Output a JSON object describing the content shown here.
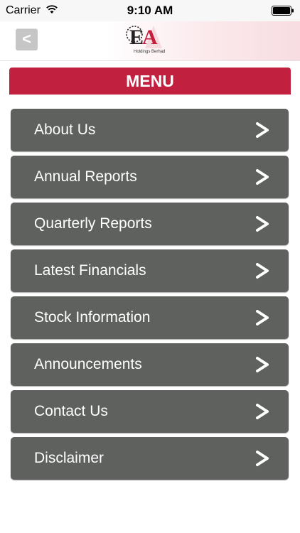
{
  "status_bar": {
    "carrier": "Carrier",
    "time": "9:10 AM",
    "wifi_icon": "wifi-icon",
    "battery_icon": "battery-icon"
  },
  "nav_bar": {
    "back_label": "<",
    "back_icon": "chevron-left-icon",
    "logo": {
      "letters_e": "E",
      "letters_a": "A",
      "subtitle": "Holdings Berhad"
    }
  },
  "menu": {
    "title": "MENU",
    "items": [
      {
        "label": "About Us"
      },
      {
        "label": "Annual Reports"
      },
      {
        "label": "Quarterly Reports"
      },
      {
        "label": "Latest Financials"
      },
      {
        "label": "Stock Information"
      },
      {
        "label": "Announcements"
      },
      {
        "label": "Contact Us"
      },
      {
        "label": "Disclaimer"
      }
    ],
    "arrow_icon": "chevron-right-icon"
  },
  "colors": {
    "accent": "#c1203f",
    "menu_item_bg": "#5f615f",
    "menu_text": "#ffffff"
  }
}
